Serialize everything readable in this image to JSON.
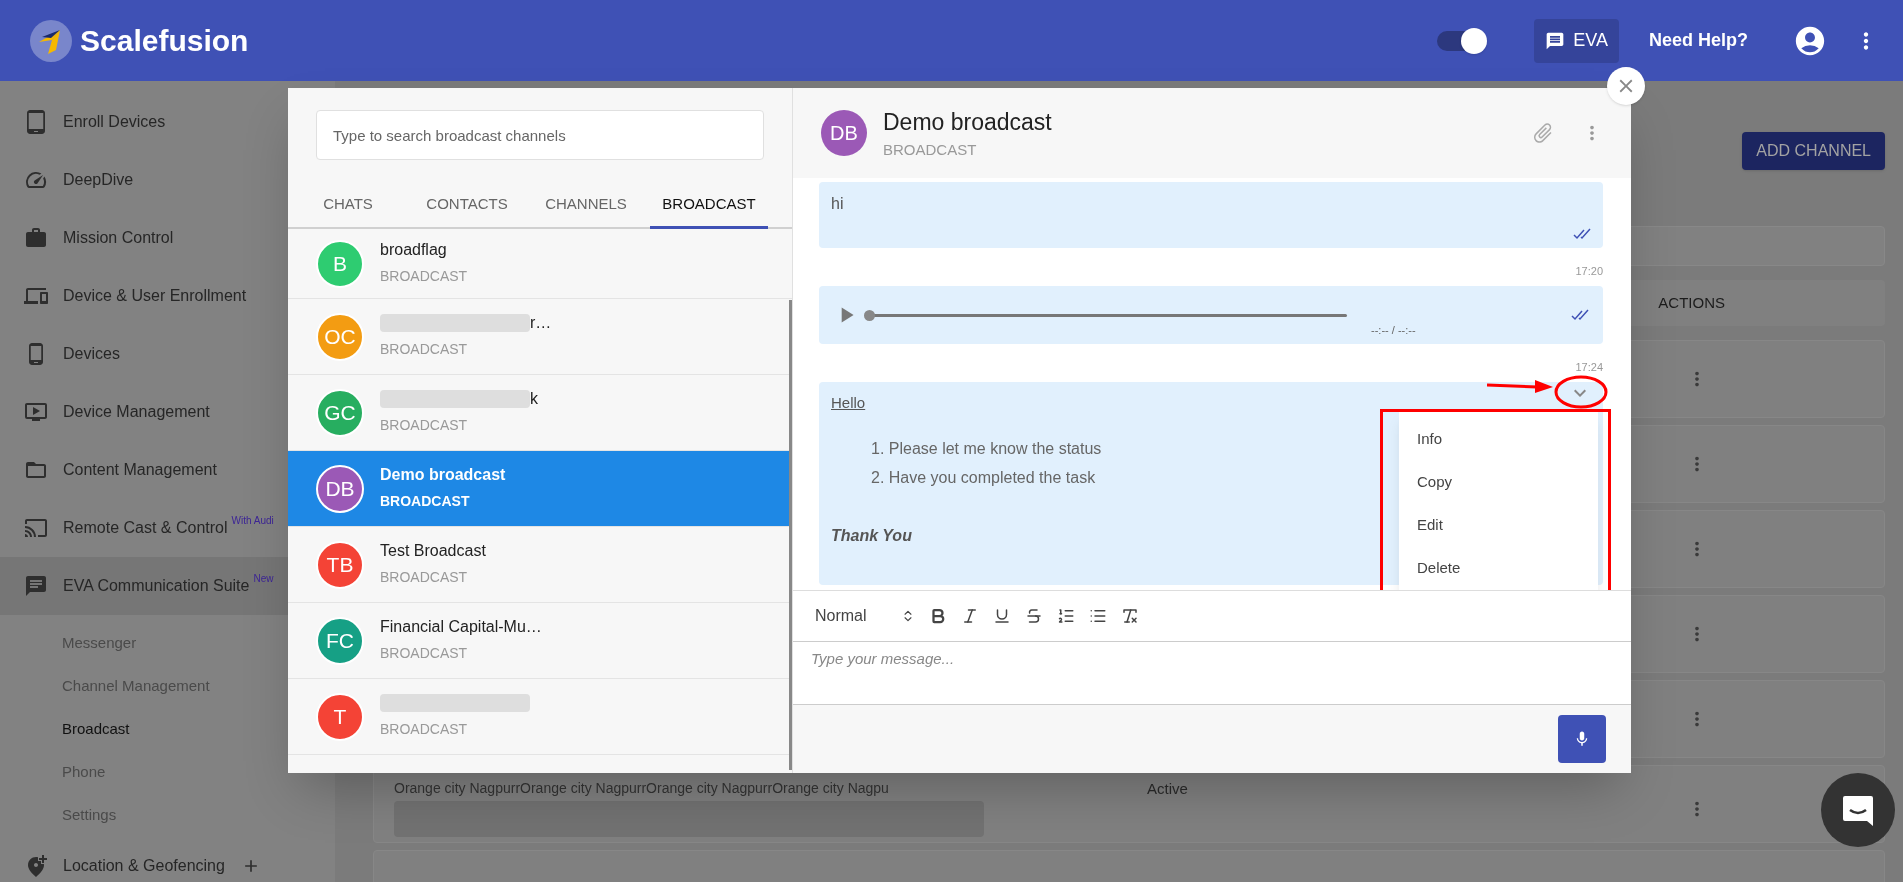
{
  "header": {
    "logo_text": "Scalefusion",
    "toggle": {
      "on": true
    },
    "eva_button": "EVA",
    "help_link": "Need Help?"
  },
  "sidebar": {
    "items": [
      {
        "label": "Enroll Devices",
        "selected": false
      },
      {
        "label": "DeepDive",
        "selected": false
      },
      {
        "label": "Mission Control",
        "selected": false
      },
      {
        "label": "Device & User Enrollment",
        "selected": false
      },
      {
        "label": "Devices",
        "selected": false
      },
      {
        "label": "Device Management",
        "selected": false
      },
      {
        "label": "Content Management",
        "selected": false
      },
      {
        "label": "Remote Cast & Control",
        "badge": "With Audi",
        "selected": false
      },
      {
        "label": "EVA Communication Suite",
        "badge": "New",
        "selected": true,
        "children": [
          {
            "label": "Messenger",
            "selected": false
          },
          {
            "label": "Channel Management",
            "selected": false
          },
          {
            "label": "Broadcast",
            "selected": true
          },
          {
            "label": "Phone",
            "selected": false
          },
          {
            "label": "Settings",
            "selected": false
          }
        ]
      },
      {
        "label": "Location & Geofencing",
        "selected": false
      }
    ]
  },
  "background": {
    "add_button": "ADD CHANNEL",
    "table": {
      "columns": [
        {
          "label": "ACTIONS"
        }
      ],
      "rows": [
        {
          "name": "Orange city NagpurrOrange city NagpurrOrange city NagpurrOrange city Nagpu",
          "redacted": true,
          "status": "Active"
        }
      ]
    }
  },
  "dialog": {
    "search": {
      "placeholder": "Type to search broadcast channels"
    },
    "tabs": [
      {
        "label": "CHATS",
        "selected": false
      },
      {
        "label": "CONTACTS",
        "selected": false
      },
      {
        "label": "CHANNELS",
        "selected": false
      },
      {
        "label": "BROADCAST",
        "selected": true
      }
    ],
    "list": [
      {
        "initials": "B",
        "color": "#2ecc71",
        "name": "broadflag",
        "redacted": false,
        "type": "BROADCAST",
        "selected": false
      },
      {
        "initials": "OC",
        "color": "#f39c12",
        "name": "r…",
        "redacted": true,
        "type": "BROADCAST",
        "selected": false
      },
      {
        "initials": "GC",
        "color": "#27ae60",
        "name": "k",
        "redacted": true,
        "type": "BROADCAST",
        "selected": false
      },
      {
        "initials": "DB",
        "color": "#9b59b6",
        "name": "Demo broadcast",
        "redacted": false,
        "type": "BROADCAST",
        "selected": true
      },
      {
        "initials": "TB",
        "color": "#f44336",
        "name": "Test Broadcast",
        "redacted": false,
        "type": "BROADCAST",
        "selected": false
      },
      {
        "initials": "FC",
        "color": "#16a085",
        "name": "Financial Capital-Mu…",
        "redacted": false,
        "type": "BROADCAST",
        "selected": false
      },
      {
        "initials": "T",
        "color": "#f44336",
        "redacted": true,
        "type": "BROADCAST",
        "selected": false
      }
    ],
    "chat": {
      "initials": "DB",
      "color": "#9b59b6",
      "title": "Demo broadcast",
      "subtitle": "BROADCAST",
      "messages": [
        {
          "kind": "text",
          "text": "hi",
          "read": true,
          "time": "17:20"
        },
        {
          "kind": "audio",
          "level": 0,
          "duration": "--:-- / --:--",
          "read": true,
          "time": "17:24"
        },
        {
          "kind": "rich",
          "title": "Hello",
          "items": [
            {
              "number": "1.",
              "text": "Please let me know the status"
            },
            {
              "number": "2.",
              "text": "Have you completed the task"
            }
          ],
          "signoff": "Thank You",
          "read": false
        }
      ],
      "menu": [
        "Info",
        "Copy",
        "Edit",
        "Delete"
      ],
      "format": "Normal",
      "input": {
        "placeholder": "Type your message..."
      }
    }
  }
}
